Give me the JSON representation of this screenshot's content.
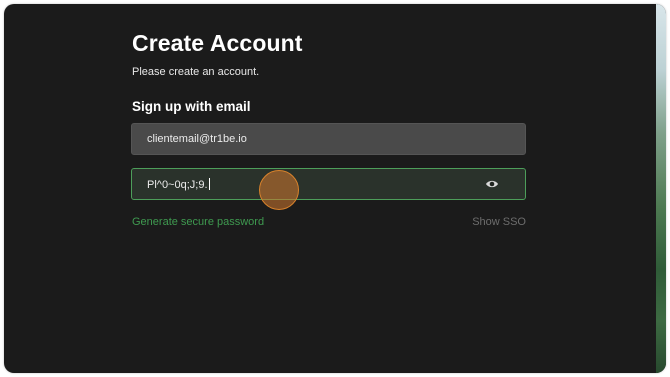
{
  "header": {
    "title": "Create Account",
    "subtitle": "Please create an account."
  },
  "form": {
    "section_title": "Sign up with email",
    "email_value": "clientemail@tr1be.io",
    "password_value": "Pl^0~0q;J;9.",
    "password_visibility_icon": "eye-icon",
    "generate_password_label": "Generate secure password",
    "show_sso_label": "Show SSO"
  },
  "colors": {
    "background": "#1b1b1b",
    "accent_green": "#3f9a50",
    "focus_border": "#4d9e5a",
    "cursor_highlight": "#d9822b"
  }
}
